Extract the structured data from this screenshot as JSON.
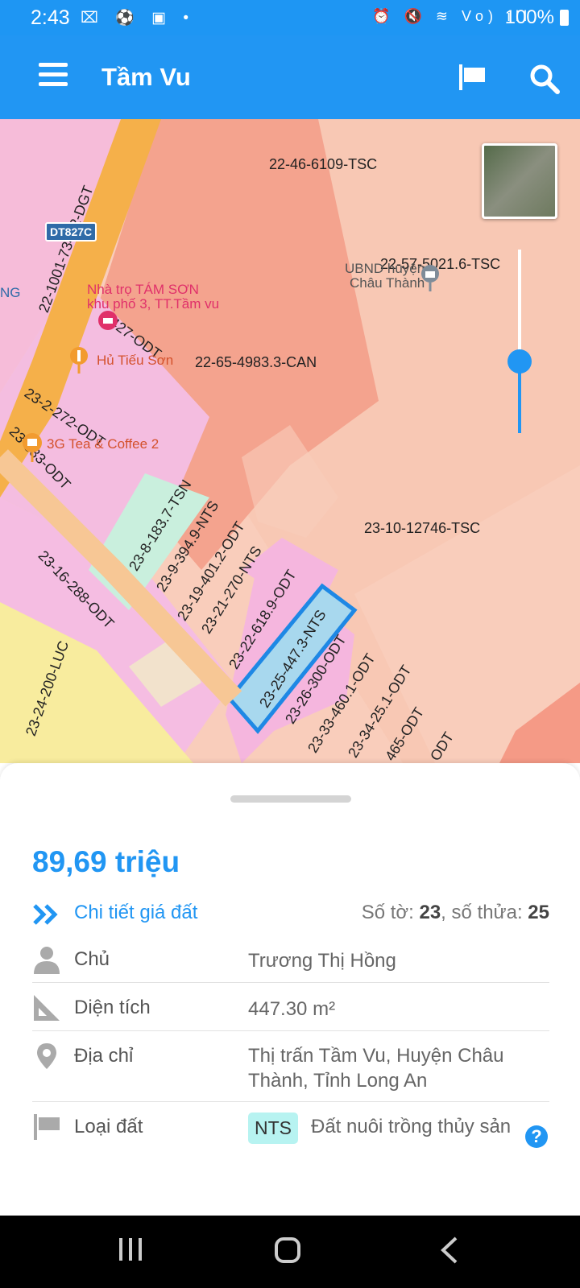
{
  "status": {
    "time": "2:43",
    "battery": "100%",
    "left_icons": "⌧ ⚽ ▣ •",
    "right_icons": "⏰ 🔇 ≋ Vo) ıll"
  },
  "app": {
    "title": "Tầm Vu"
  },
  "map": {
    "labels": [
      "22-46-6109-TSC",
      "22-57-5021.6-TSC",
      "22-65-4983.3-CAN",
      "23-10-12746-TSC",
      "22-1001-73412-DGT",
      "427-ODT",
      "23-2-272-ODT",
      "23-333-ODT",
      "23-16-288-ODT",
      "23-8-183.7-TSN",
      "23-9-394.9-NTS",
      "23-19-401.2-ODT",
      "23-21-270-NTS",
      "23-22-618.9-ODT",
      "23-25-447.3-NTS",
      "23-26-300-ODT",
      "23-33-460.1-ODT",
      "23-34-25.1-ODT",
      "465-ODT",
      "ODT",
      "23-24-200-LUC"
    ],
    "pois": {
      "nha_tro": "Nhà trọ TÁM SƠN",
      "nha_tro_sub": "khu phố 3, TT.Tầm vu",
      "hu_tieu": "Hủ Tiếu Sơn",
      "tea": "3G Tea & Coffee 2",
      "ubnd": "UBND huyện",
      "ubnd2": "Châu Thành",
      "ng": "NG"
    },
    "road": "DT827C"
  },
  "sheet": {
    "price": "89,69 triệu",
    "detail_link": "Chi tiết giá đất",
    "so_to_label": "Số tờ: ",
    "so_to": "23",
    "so_thua_label": ", số thửa: ",
    "so_thua": "25",
    "rows": [
      {
        "label": "Chủ",
        "value": "Trương Thị Hồng"
      },
      {
        "label": "Diện tích",
        "value": "447.30 m²"
      },
      {
        "label": "Địa chỉ",
        "value": "Thị trấn Tầm Vu, Huyện Châu Thành, Tỉnh Long An"
      },
      {
        "label": "Loại đất",
        "code": "NTS",
        "value": "Đất nuôi trồng thủy sản"
      }
    ],
    "help": "?"
  }
}
